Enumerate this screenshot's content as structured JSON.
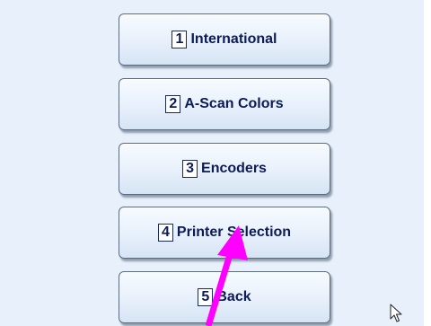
{
  "menu": {
    "items": [
      {
        "number": "1",
        "label": "International"
      },
      {
        "number": "2",
        "label": "A-Scan Colors"
      },
      {
        "number": "3",
        "label": "Encoders"
      },
      {
        "number": "4",
        "label": "Printer Selection"
      },
      {
        "number": "5",
        "label": "Back"
      }
    ]
  },
  "annotation": {
    "arrow_color": "#ff00ff",
    "arrow_icon": "pointer-arrow",
    "cursor_icon": "mouse-cursor"
  },
  "colors": {
    "background": "#e8f1fb",
    "text": "#0d1b57",
    "button_border": "#5a6b82"
  }
}
